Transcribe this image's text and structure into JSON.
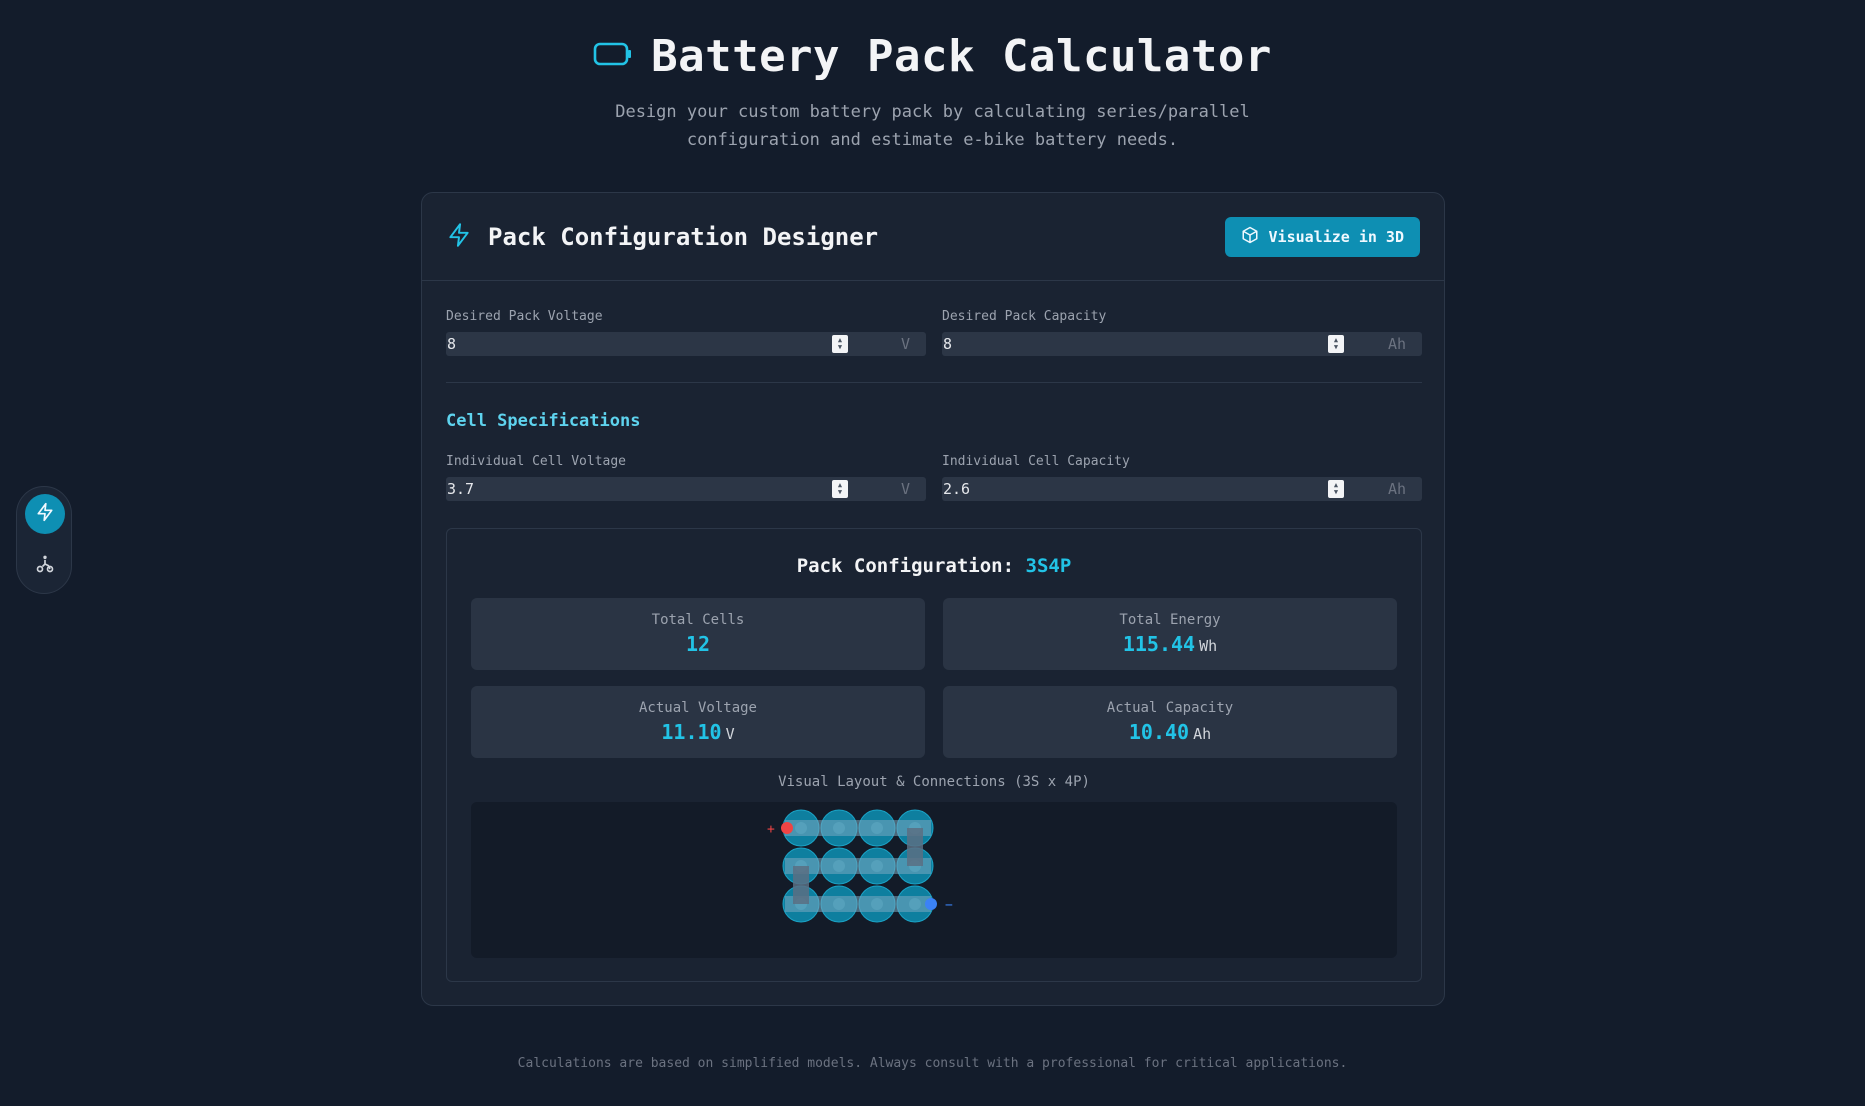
{
  "header": {
    "title": "Battery Pack Calculator",
    "subtitle": "Design your custom battery pack by calculating series/parallel configuration and estimate e-bike battery needs."
  },
  "side_nav": {
    "items": [
      "zap-icon",
      "bike-icon"
    ],
    "active": "zap-icon"
  },
  "designer": {
    "title": "Pack Configuration Designer",
    "visualize_label": "Visualize in 3D",
    "fields": {
      "pack_voltage": {
        "label": "Desired Pack Voltage",
        "value": "8",
        "unit": "V"
      },
      "pack_capacity": {
        "label": "Desired Pack Capacity",
        "value": "8",
        "unit": "Ah"
      },
      "cell_voltage": {
        "label": "Individual Cell Voltage",
        "value": "3.7",
        "unit": "V"
      },
      "cell_capacity": {
        "label": "Individual Cell Capacity",
        "value": "2.6",
        "unit": "Ah"
      }
    },
    "cell_section_title": "Cell Specifications"
  },
  "result": {
    "title_prefix": "Pack Configuration:",
    "config": "3S4P",
    "stats": {
      "total_cells": {
        "label": "Total Cells",
        "value": "12",
        "unit": ""
      },
      "total_energy": {
        "label": "Total Energy",
        "value": "115.44",
        "unit": "Wh"
      },
      "actual_voltage": {
        "label": "Actual Voltage",
        "value": "11.10",
        "unit": "V"
      },
      "actual_capacity": {
        "label": "Actual Capacity",
        "value": "10.40",
        "unit": "Ah"
      }
    },
    "layout_label": "Visual Layout & Connections (3S x 4P)",
    "layout": {
      "series": 3,
      "parallel": 4,
      "positive_label": "+",
      "negative_label": "−"
    }
  },
  "colors": {
    "accent": "#22c3e6",
    "button": "#0e8fb3",
    "positive": "#ef4444",
    "negative": "#3b82f6"
  },
  "footer": "Calculations are based on simplified models. Always consult with a professional for critical applications."
}
